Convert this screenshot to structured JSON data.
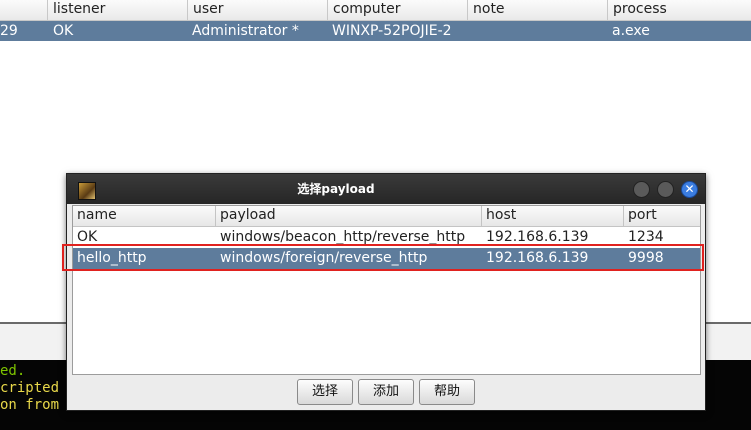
{
  "background_table": {
    "headers": [
      "listener",
      "user",
      "computer",
      "note",
      "process"
    ],
    "row": {
      "id_partial": "29",
      "listener": "OK",
      "user": "Administrator *",
      "computer": "WINXP-52POJIE-2",
      "note": "",
      "process": "a.exe"
    }
  },
  "console": {
    "lines": [
      "ed.",
      "cripted W",
      "on from A"
    ]
  },
  "dialog": {
    "title": "选择payload",
    "table": {
      "headers": [
        "name",
        "payload",
        "host",
        "port"
      ],
      "rows": [
        {
          "name": "OK",
          "payload": "windows/beacon_http/reverse_http",
          "host": "192.168.6.139",
          "port": "1234"
        },
        {
          "name": "hello_http",
          "payload": "windows/foreign/reverse_http",
          "host": "192.168.6.139",
          "port": "9998"
        }
      ],
      "selected_row": 1
    },
    "buttons": {
      "choose": "选择",
      "add": "添加",
      "help": "帮助"
    },
    "close_glyph": "✕"
  },
  "colors": {
    "selection": "#5e7c9c",
    "highlight": "#e0221f",
    "console_green": "#7ec400",
    "console_yellow": "#e8d84a",
    "close_button": "#3b7de0"
  }
}
